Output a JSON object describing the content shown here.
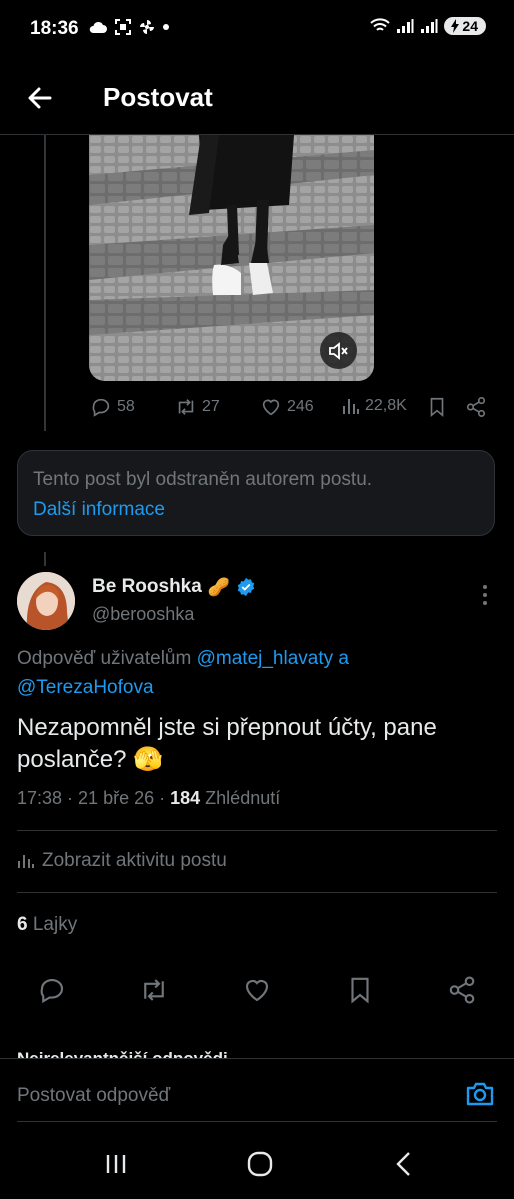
{
  "status_bar": {
    "time": "18:36",
    "battery": "24"
  },
  "header": {
    "title": "Postovat"
  },
  "parent_post": {
    "actions": {
      "replies": "58",
      "reposts": "27",
      "likes": "246",
      "views": "22,8K"
    }
  },
  "deleted_notice": {
    "text": "Tento post byl odstraněn autorem postu.",
    "link": "Další informace"
  },
  "reply": {
    "author_name": "Be Rooshka",
    "author_emoji": "🥜",
    "handle": "@berooshka",
    "reply_prefix": "Odpověď uživatelům",
    "mention1": "@matej_hlavaty",
    "conjunction": "a",
    "mention2": "@TerezaHofova",
    "text": "Nezapomněl jste si přepnout účty, pane poslanče? 🫣",
    "time": "17:38",
    "date": "21 bře 26",
    "views_count": "184",
    "views_label": "Zhlédnutí",
    "activity_label": "Zobrazit aktivitu postu",
    "likes_count": "6",
    "likes_label": "Lajky"
  },
  "sort_filter": {
    "label": "Nejrelevantnější odpovědi"
  },
  "compose": {
    "placeholder": "Postovat odpověď"
  },
  "colors": {
    "accent": "#1d9bf0",
    "muted": "#71767b",
    "border": "#2f3336",
    "verified": "#1d9bf0"
  },
  "icons": [
    "back-arrow-icon",
    "reply-icon",
    "repost-icon",
    "like-icon",
    "views-icon",
    "bookmark-icon",
    "share-icon",
    "mute-icon",
    "more-icon",
    "camera-icon",
    "verified-badge-icon",
    "recents-icon",
    "home-icon",
    "nav-back-icon"
  ]
}
